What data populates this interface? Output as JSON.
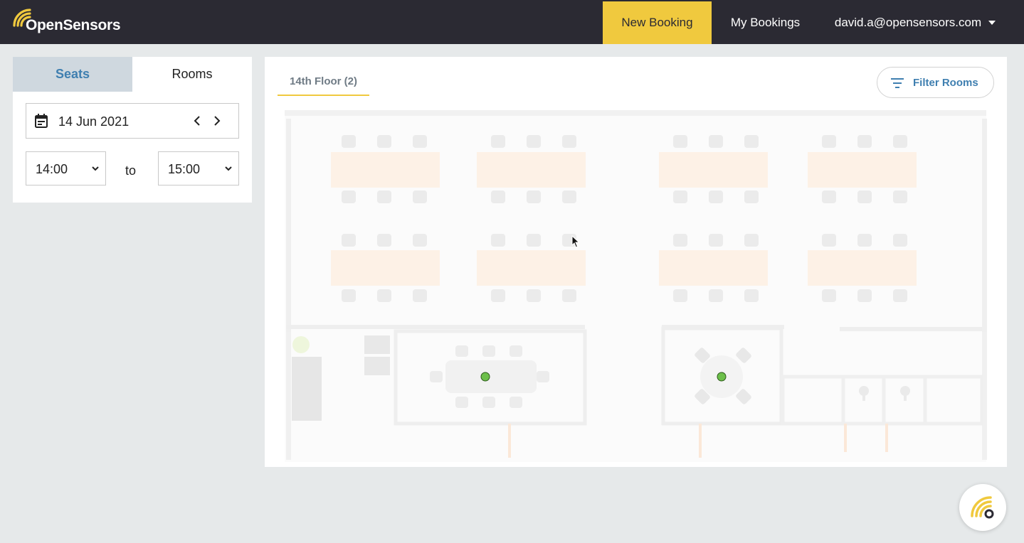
{
  "brand": {
    "name": "OpenSensors"
  },
  "nav": {
    "new_booking": "New Booking",
    "my_bookings": "My Bookings",
    "user_email": "david.a@opensensors.com"
  },
  "panel": {
    "tabs": {
      "seats": "Seats",
      "rooms": "Rooms"
    },
    "date": "14 Jun 2021",
    "start_time": "14:00",
    "connector": "to",
    "end_time": "15:00"
  },
  "map": {
    "floor_tab": "14th Floor (2)",
    "filter_label": "Filter Rooms",
    "available_rooms": 2
  },
  "colors": {
    "accent_yellow": "#f0c93e",
    "nav_dark": "#2b2a33",
    "link_blue": "#3f7fb0",
    "room_available": "#6cbf4a"
  }
}
